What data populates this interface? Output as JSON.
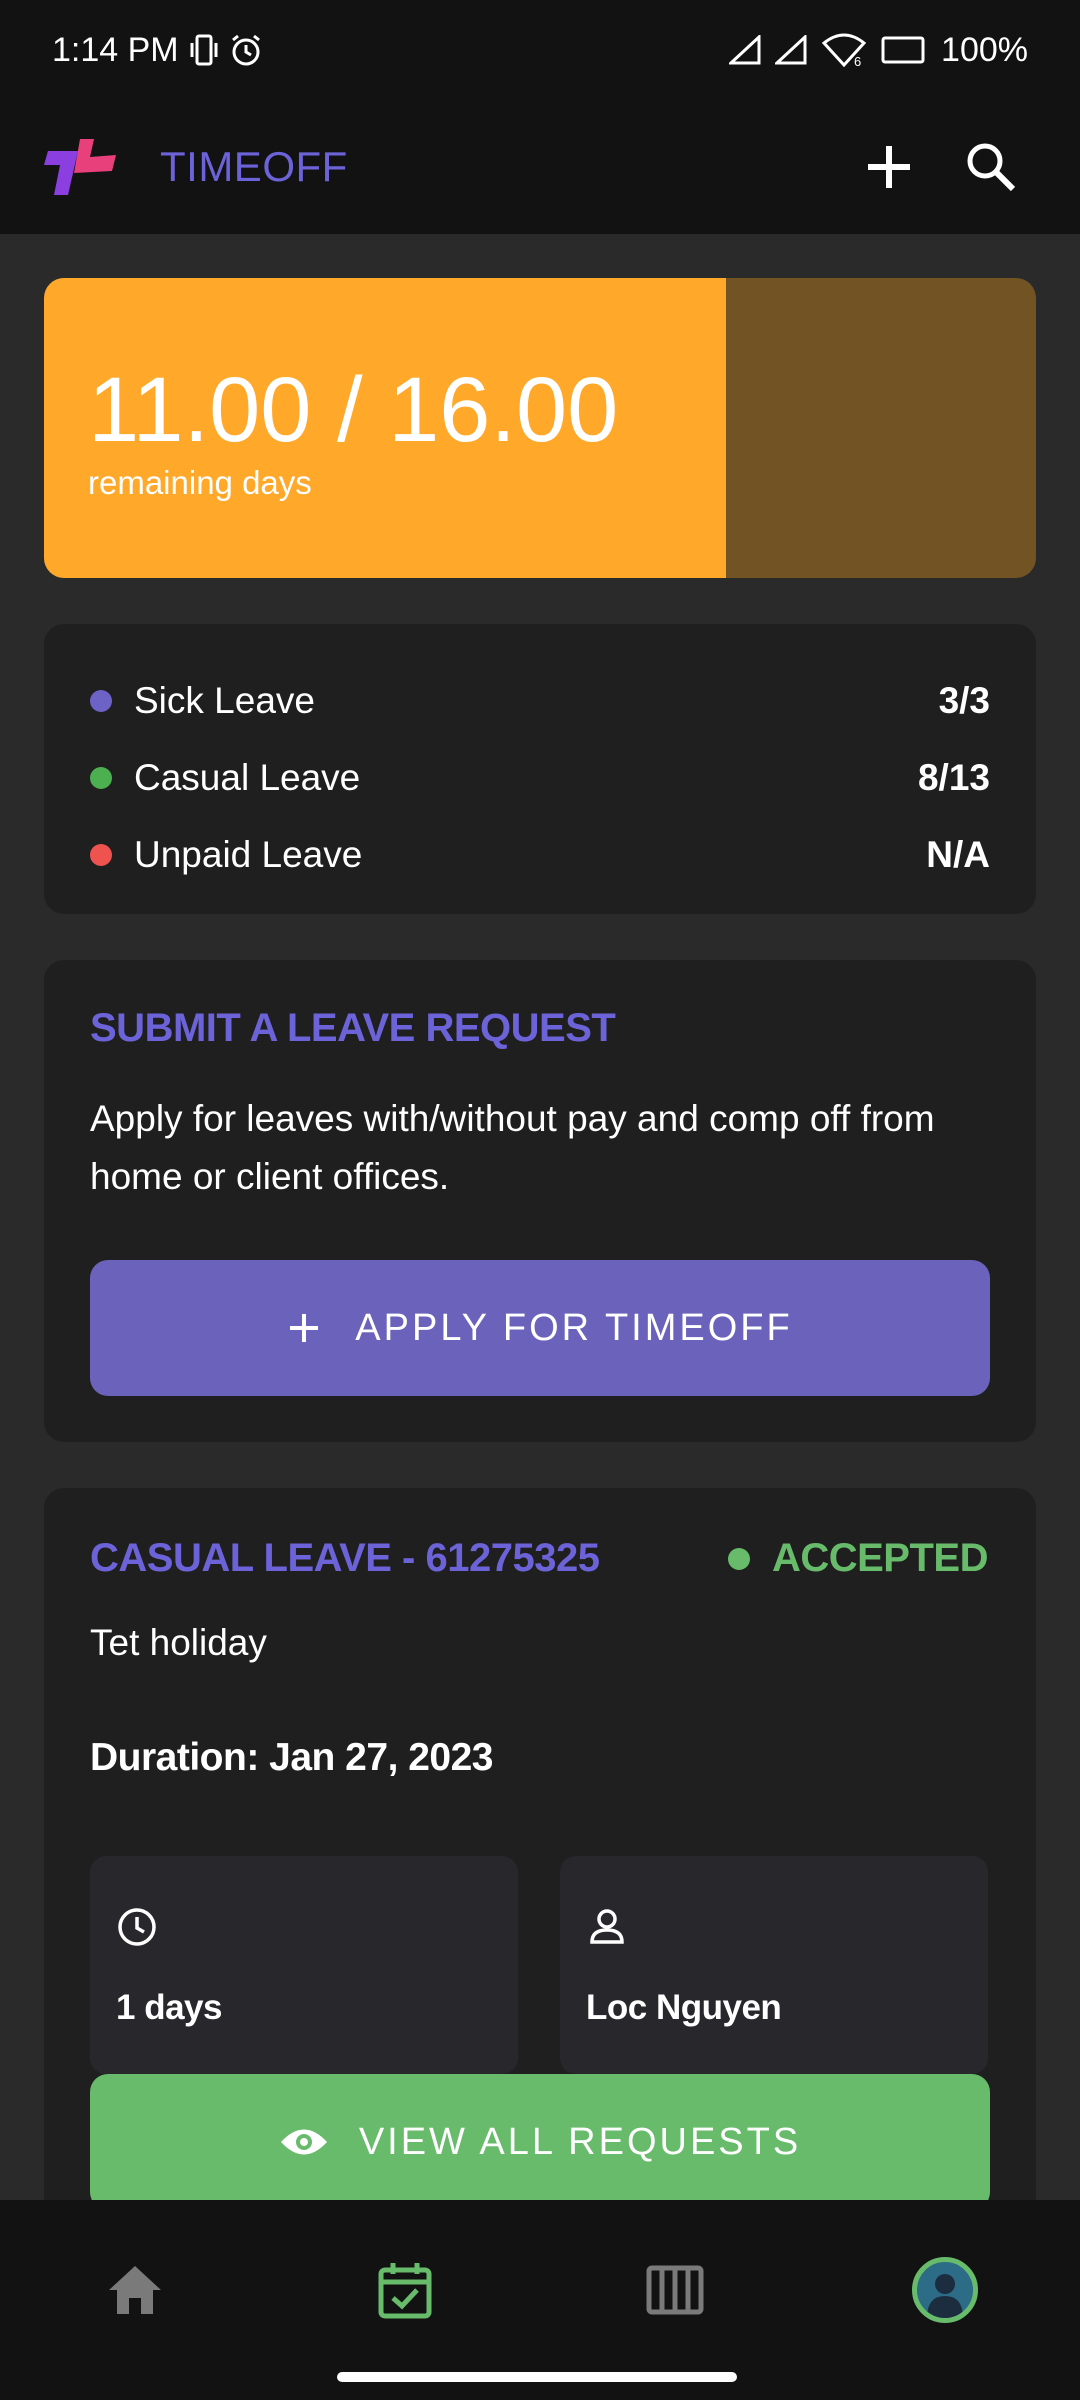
{
  "status_bar": {
    "time": "1:14 PM",
    "battery": "100%",
    "icons": [
      "vibrate-icon",
      "alarm-icon",
      "signal-icon",
      "signal-icon",
      "wifi-icon",
      "battery-icon"
    ]
  },
  "app_bar": {
    "title": "TIMEOFF",
    "title_color": "#6d63d9",
    "actions": [
      "plus-icon",
      "search-icon"
    ]
  },
  "balance": {
    "value": "11.00 / 16.00",
    "label": "remaining days",
    "remaining": 11.0,
    "total": 16.0,
    "fill_color": "#ffa82a",
    "track_color": "#715324"
  },
  "leave_types": [
    {
      "name": "Sick Leave",
      "value": "3/3",
      "color": "#6d63c6"
    },
    {
      "name": "Casual Leave",
      "value": "8/13",
      "color": "#4caf50"
    },
    {
      "name": "Unpaid Leave",
      "value": "N/A",
      "color": "#ef5350"
    }
  ],
  "submit": {
    "title": "SUBMIT A LEAVE REQUEST",
    "description": "Apply for leaves with/without pay and comp off from home or client offices.",
    "button_label": "APPLY FOR TIMEOFF",
    "button_color": "#6b63bb"
  },
  "request": {
    "title": "CASUAL LEAVE - 61275325",
    "status": "ACCEPTED",
    "status_color": "#67bb6b",
    "reason": "Tet holiday",
    "duration": "Duration: Jan 27, 2023",
    "days": "1 days",
    "approver": "Loc Nguyen",
    "view_button_label": "VIEW ALL REQUESTS",
    "view_button_color": "#67bb6b"
  },
  "bottom_nav": {
    "items": [
      "home-icon",
      "calendar-check-icon",
      "board-icon",
      "avatar"
    ],
    "active": "calendar-check-icon"
  }
}
